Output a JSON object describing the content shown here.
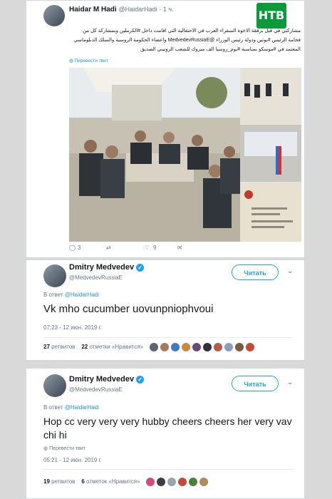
{
  "tweet1": {
    "author_name": "Haidar M Hadi",
    "author_handle": "@HaidarHadi",
    "time_ago": "· 1 ч.",
    "text": "مشاركتي في قبل برفقة الاخوة السفراء العرب في الاحتفالية التي اقامت داخل #الكرملين وبمشاركة كل من فخامة الرئيس #بوتين ودولة رئيس الوزراء @MedvedevRussiaE واعضاء الحكومة الروسية والسلك الدبلوماسي المعتمد في #موسكو بمناسبة #يوم_روسيا الف مبروك للشعب الروسي الصديق",
    "translate_label": "Перевести твит",
    "replies": "3",
    "likes": "9"
  },
  "tweet2": {
    "author_name": "Dmitry Medvedev",
    "author_handle": "@MedvedevRussiaE",
    "follow_label": "Читать",
    "reply_prefix": "В ответ",
    "reply_to": "@HaidarHadi",
    "text": "Vk mho cucumber uovunpniophvoui",
    "timestamp": "07:23 - 12 июн. 2019 г.",
    "retweets": "27",
    "retweets_label": "ретвитов",
    "likes": "22",
    "likes_label": "отметки «Нравится»"
  },
  "tweet3": {
    "author_name": "Dmitry Medvedev",
    "author_handle": "@MedvedevRussiaE",
    "follow_label": "Читать",
    "reply_prefix": "В ответ",
    "reply_to": "@HaidarHadi",
    "text": "Hop cc very very very hubby cheers cheers her very vav chi hi",
    "translate_label": "Перевести твит",
    "timestamp": "05:21 - 12 июн. 2019 г.",
    "retweets": "19",
    "retweets_label": "ретвитов",
    "likes": "6",
    "likes_label": "отметок «Нравится»"
  },
  "logo": {
    "text": "НТВ"
  },
  "colors": {
    "accent": "#1da1f2",
    "ntv_green": "#0a9a3a",
    "background": "#d9d9d9"
  }
}
